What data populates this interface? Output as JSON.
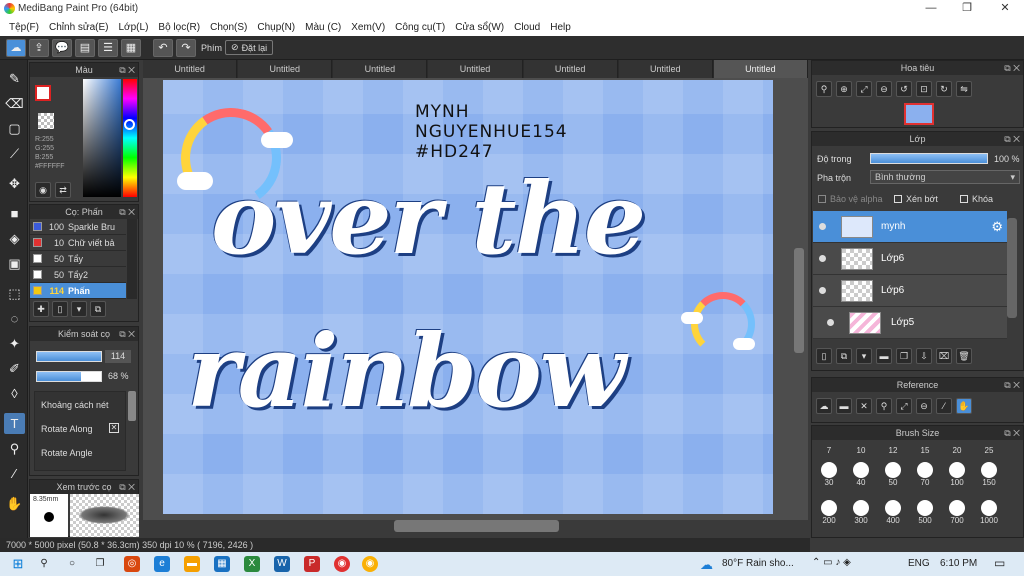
{
  "window": {
    "title": "MediBang Paint Pro (64bit)"
  },
  "menu": [
    "Tệp(F)",
    "Chỉnh sửa(E)",
    "Lớp(L)",
    "Bộ lọc(R)",
    "Chọn(S)",
    "Chụp(N)",
    "Màu (C)",
    "Xem(V)",
    "Công cụ(T)",
    "Cửa sổ(W)",
    "Cloud",
    "Help"
  ],
  "toolbar": {
    "phim_label": "Phím",
    "reset_label": "Đặt lại"
  },
  "tabs": [
    "Untitled",
    "Untitled",
    "Untitled",
    "Untitled",
    "Untitled",
    "Untitled",
    "Untitled"
  ],
  "color_panel": {
    "title": "Màu",
    "r": "R:255",
    "g": "G:255",
    "b": "B:255",
    "hex": "#FFFFFF"
  },
  "brush_panel": {
    "title": "Cọ: Phấn",
    "items": [
      {
        "size": "100",
        "name": "Sparkle Bru",
        "color": "#3b5bdb"
      },
      {
        "size": "10",
        "name": "Chữ viết bả",
        "color": "#e03131"
      },
      {
        "size": "50",
        "name": "Tẩy",
        "color": "#ffffff"
      },
      {
        "size": "50",
        "name": "Tẩy2",
        "color": "#ffffff"
      },
      {
        "size": "114",
        "name": "Phấn",
        "color": "#f2c811"
      }
    ]
  },
  "control_panel": {
    "title": "Kiểm soát cọ",
    "size": "114",
    "opacity": "68 %",
    "spacing": "Khoảng cách nét",
    "rotate_along": "Rotate Along",
    "rotate_angle": "Rotate Angle"
  },
  "preview_panel": {
    "title": "Xem trước cọ",
    "size": "8.35mm"
  },
  "artwork": {
    "line1": "MYNH",
    "line2": "NGUYENHUE154",
    "line3": "#HD247",
    "word1": "over the",
    "word2": "rainbow"
  },
  "navigator": {
    "title": "Hoa tiêu"
  },
  "layer_panel": {
    "title": "Lớp",
    "opacity_label": "Độ trong",
    "opacity_value": "100 %",
    "blend_label": "Pha trộn",
    "blend_value": "Bình thường",
    "protect_alpha": "Bảo vệ alpha",
    "clipping": "Xén bớt",
    "lock": "Khóa",
    "layers": [
      {
        "name": "mynh"
      },
      {
        "name": "Lớp6"
      },
      {
        "name": "Lớp6"
      },
      {
        "name": "Lớp5"
      }
    ]
  },
  "reference_panel": {
    "title": "Reference"
  },
  "brush_size_panel": {
    "title": "Brush Size",
    "row0": [
      "7",
      "10",
      "12",
      "15",
      "20",
      "25"
    ],
    "row1": [
      "30",
      "40",
      "50",
      "70",
      "100",
      "150"
    ],
    "row2": [
      "200",
      "300",
      "400",
      "500",
      "700",
      "1000"
    ]
  },
  "status": {
    "text": "7000 * 5000 pixel   (50.8 * 36.3cm)   350 dpi   10 %   ( 7196, 2426 )"
  },
  "taskbar": {
    "weather": "80°F  Rain sho...",
    "lang": "ENG",
    "time": "6:10 PM"
  }
}
